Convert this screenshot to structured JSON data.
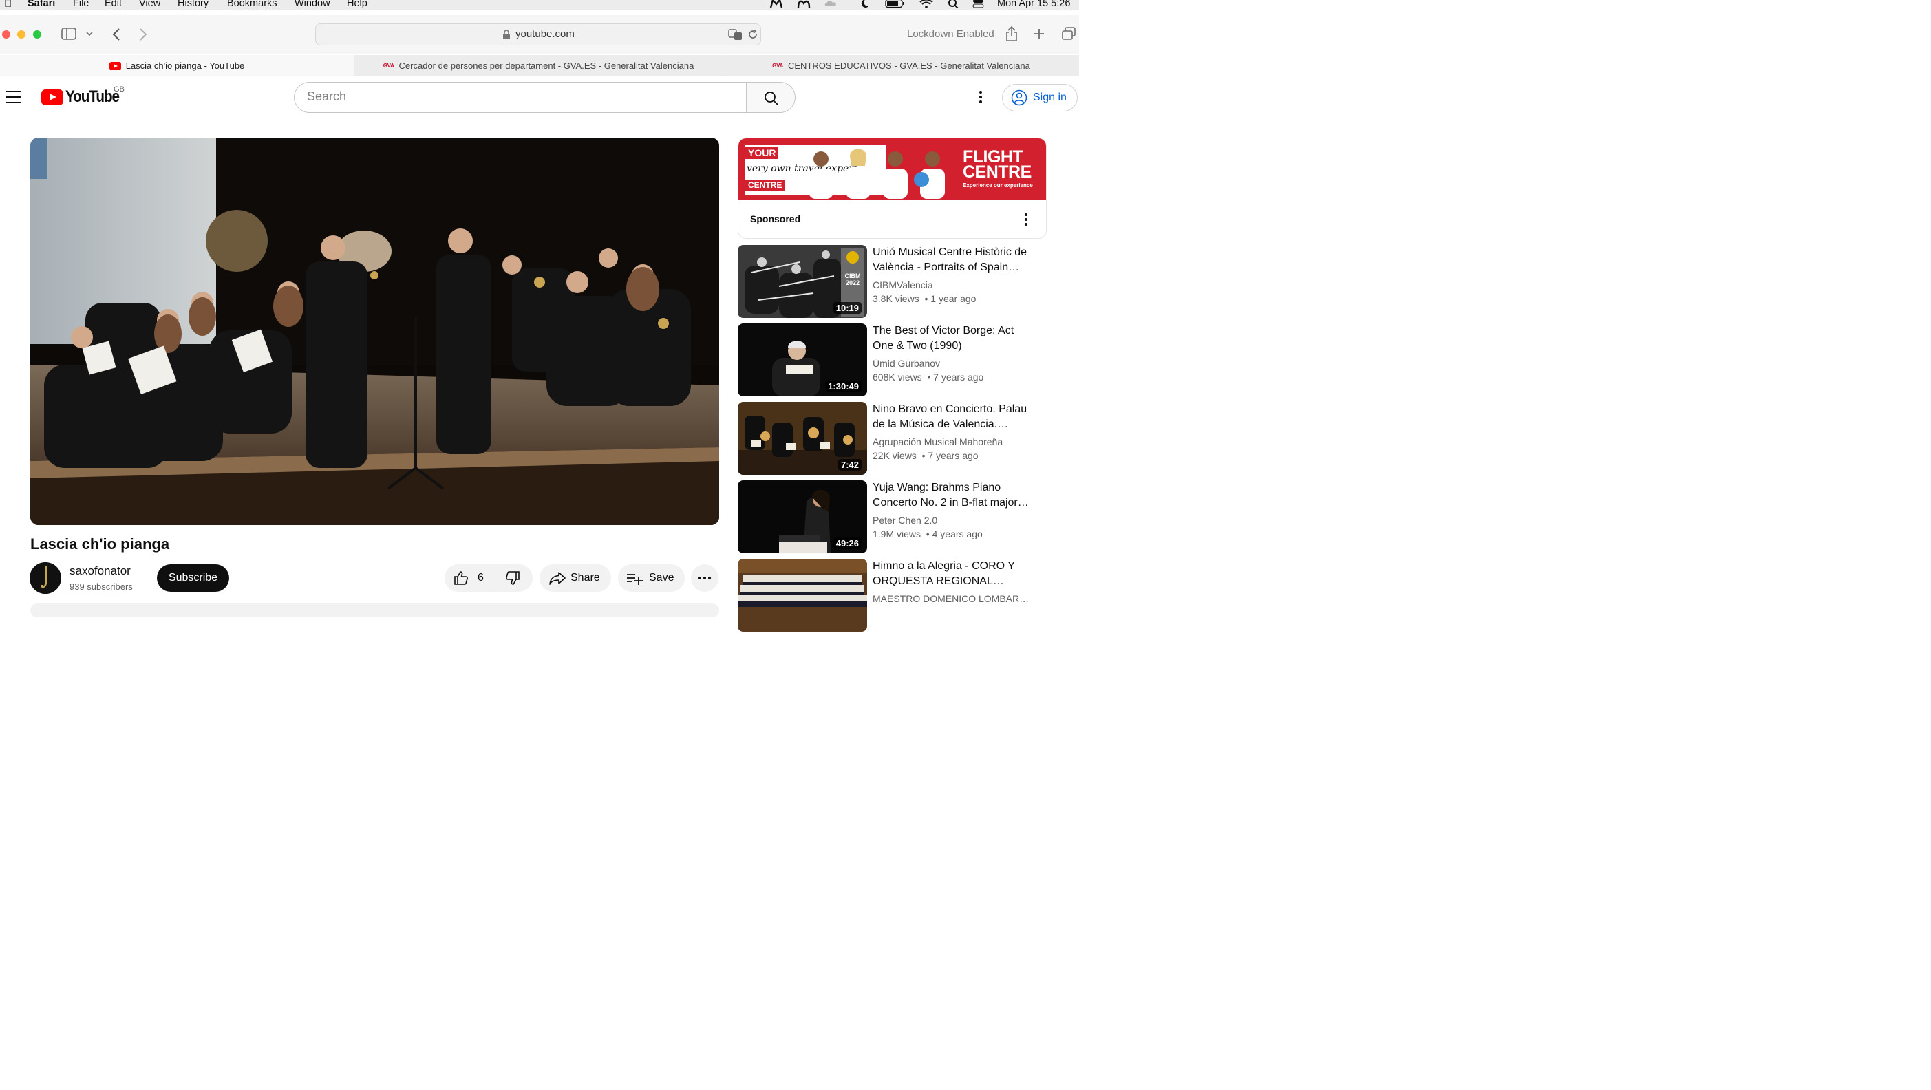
{
  "menubar": {
    "app": "Safari",
    "items": [
      "File",
      "Edit",
      "View",
      "History",
      "Bookmarks",
      "Window",
      "Help"
    ],
    "clock": "Mon Apr 15  5:26"
  },
  "safari": {
    "url": "youtube.com",
    "lockdown": "Lockdown Enabled",
    "tabs": [
      {
        "title": "Lascia ch'io pianga - YouTube",
        "favicon": "youtube-icon"
      },
      {
        "title": "Cercador de persones per departament - GVA.ES - Generalitat Valenciana",
        "favicon": "gva-icon"
      },
      {
        "title": "CENTROS EDUCATIVOS - GVA.ES - Generalitat Valenciana",
        "favicon": "gva-icon"
      }
    ],
    "gva_favicon_text": "GVA"
  },
  "youtube": {
    "wordmark": "YouTube",
    "country": "GB",
    "search_placeholder": "Search",
    "signin_label": "Sign in",
    "brand_color": "#ff0000",
    "link_color": "#065fd4"
  },
  "video": {
    "title": "Lascia ch'io pianga",
    "channel": "saxofonator",
    "subscribers": "939 subscribers",
    "subscribe_label": "Subscribe",
    "likes": "6",
    "share_label": "Share",
    "save_label": "Save"
  },
  "ad": {
    "banner_line1": "YOUR",
    "banner_line2": "very own travel expert",
    "banner_line3": "CENTRE",
    "brand": "FLIGHT CENTRE",
    "tagline": "Experience our experience",
    "sponsored_label": "Sponsored"
  },
  "recommendations": [
    {
      "title": "Unió Musical Centre Històric de València - Portraits of Spain…",
      "channel": "CIBMValencia",
      "views": "3.8K views",
      "age": "1 year ago",
      "duration": "10:19",
      "badge": "CIBM 2022"
    },
    {
      "title": "The Best of Victor Borge: Act One & Two (1990)",
      "channel": "Ümid Gurbanov",
      "views": "608K views",
      "age": "7 years ago",
      "duration": "1:30:49"
    },
    {
      "title": "Nino Bravo en Concierto. Palau de la Música de Valencia. A.M…",
      "channel": "Agrupación Musical Mahoreña",
      "views": "22K views",
      "age": "7 years ago",
      "duration": "7:42"
    },
    {
      "title": "Yuja Wang: Brahms Piano Concerto No. 2 in B-flat major…",
      "channel": "Peter Chen 2.0",
      "views": "1.9M views",
      "age": "4 years ago",
      "duration": "49:26"
    },
    {
      "title": "Himno a la Alegria - CORO Y ORQUESTA REGIONAL…",
      "channel": "MAESTRO DOMENICO LOMBAR…",
      "views": "",
      "age": "",
      "duration": ""
    }
  ]
}
